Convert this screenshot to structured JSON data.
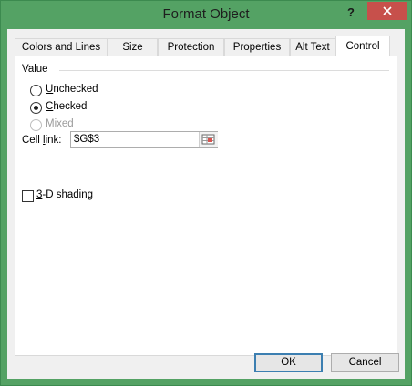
{
  "window": {
    "title": "Format Object",
    "help_label": "?"
  },
  "tabs": [
    {
      "label": "Colors and Lines",
      "active": false
    },
    {
      "label": "Size",
      "active": false
    },
    {
      "label": "Protection",
      "active": false
    },
    {
      "label": "Properties",
      "active": false
    },
    {
      "label": "Alt Text",
      "active": false
    },
    {
      "label": "Control",
      "active": true
    }
  ],
  "value_group": {
    "label": "Value",
    "options": [
      {
        "mnemonic": "U",
        "rest": "nchecked",
        "checked": false,
        "disabled": false
      },
      {
        "mnemonic": "C",
        "rest": "hecked",
        "checked": true,
        "disabled": false
      },
      {
        "mnemonic": "",
        "rest": "Mixed",
        "checked": false,
        "disabled": true
      }
    ]
  },
  "cell_link": {
    "label_pre": "Cell ",
    "label_mnemonic": "l",
    "label_post": "ink:",
    "value": "$G$3"
  },
  "shading": {
    "mnemonic": "3",
    "rest": "-D shading",
    "checked": false
  },
  "buttons": {
    "ok": "OK",
    "cancel": "Cancel"
  },
  "colors": {
    "title_bar": "#54a264",
    "close_button": "#c7504b",
    "dialog_bg": "#f0f0f0"
  }
}
